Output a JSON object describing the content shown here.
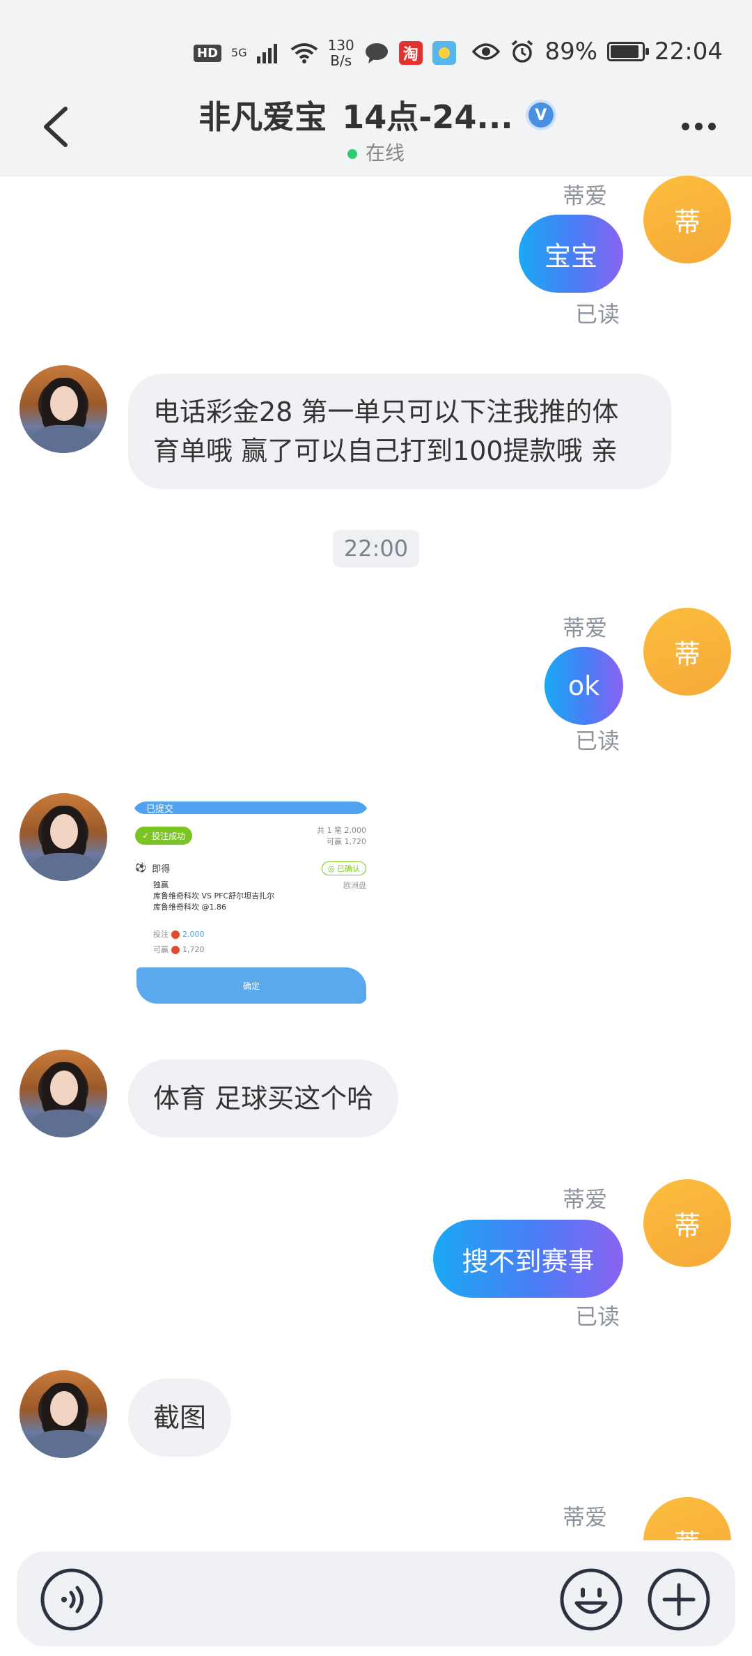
{
  "status_bar": {
    "hd": "HD",
    "network": "5G",
    "speed_value": "130",
    "speed_unit": "B/s",
    "taobao_glyph": "淘",
    "battery": "89%",
    "time": "22:04"
  },
  "header": {
    "title": "非凡爱宝",
    "subtitle_tag": "14点-24...",
    "verified_glyph": "V",
    "online_status": "在线"
  },
  "me": {
    "name": "蒂爱",
    "avatar_char": "蒂"
  },
  "messages": {
    "m1": {
      "text": "宝宝",
      "read": "已读"
    },
    "m2": {
      "line1": "电话彩金28 第一单只可以下注我推的体",
      "line2": "育单哦 赢了可以自己打到100提款哦 亲"
    },
    "timestamp": "22:00",
    "m3": {
      "text": "ok",
      "read": "已读"
    },
    "m4_image": {
      "header": "已提交",
      "success_pill": "投注成功",
      "count_line": "共 1 笔 2,000",
      "win_line": "可赢 1,720",
      "confirmed": "已确认",
      "sport": "即得",
      "region": "欧洲盘",
      "market": "独赢",
      "match": "库鲁维奇科坎 VS PFC舒尔坦吉扎尔",
      "pick": "库鲁维奇科坎 @1.86",
      "stake_label": "投注",
      "stake_value": "2,000",
      "win_label": "可赢",
      "win_value": "1,720",
      "confirm_button": "确定"
    },
    "m5": {
      "text": "体育 足球买这个哈"
    },
    "m6": {
      "text": "搜不到赛事",
      "read": "已读"
    },
    "m7": {
      "text": "截图"
    }
  },
  "colors": {
    "accent_gradient_start": "#1aa9f4",
    "accent_gradient_end": "#8a63f2",
    "my_avatar": "#fbbd3d",
    "online_dot": "#2ecc71",
    "verified": "#4a90e2"
  },
  "icons": [
    "back-icon",
    "verified-icon",
    "more-icon",
    "voice-icon",
    "emoji-icon",
    "plus-icon"
  ]
}
